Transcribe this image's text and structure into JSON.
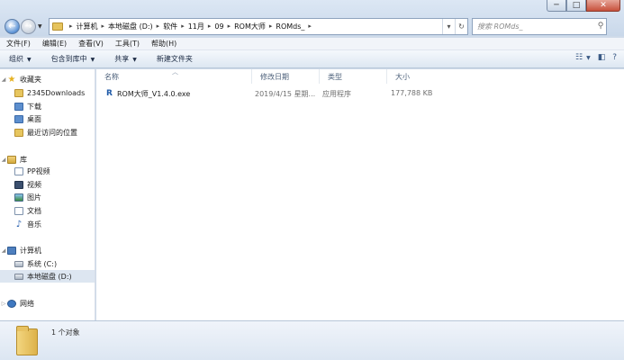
{
  "window": {
    "controls": [
      "─",
      "□",
      "✕"
    ]
  },
  "nav": {
    "back": "←",
    "forward": "→",
    "breadcrumbs": [
      "计算机",
      "本地磁盘 (D:)",
      "软件",
      "11月",
      "09",
      "ROM大师",
      "ROMds_"
    ],
    "search_placeholder": "搜索 ROMds_"
  },
  "menubar": [
    "文件(F)",
    "编辑(E)",
    "查看(V)",
    "工具(T)",
    "帮助(H)"
  ],
  "toolbar": {
    "organize": "组织",
    "include_in_library": "包含到库中",
    "share": "共享",
    "new_folder": "新建文件夹"
  },
  "sidebar": {
    "favorites": {
      "label": "收藏夹",
      "items": [
        "2345Downloads",
        "下载",
        "桌面",
        "最近访问的位置"
      ]
    },
    "libraries": {
      "label": "库",
      "items": [
        "PP视频",
        "视频",
        "图片",
        "文档",
        "音乐"
      ]
    },
    "computer": {
      "label": "计算机",
      "items": [
        "系统 (C:)",
        "本地磁盘 (D:)"
      ]
    },
    "network": {
      "label": "网络"
    }
  },
  "columns": {
    "name": "名称",
    "modified": "修改日期",
    "type": "类型",
    "size": "大小"
  },
  "files": [
    {
      "name": "ROM大师_V1.4.0.exe",
      "modified": "2019/4/15 星期...",
      "type": "应用程序",
      "size": "177,788 KB"
    }
  ],
  "status": {
    "count": "1 个对象"
  }
}
